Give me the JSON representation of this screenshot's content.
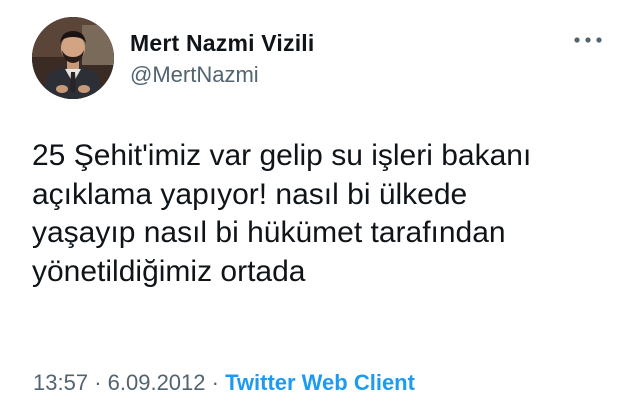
{
  "author": {
    "display_name": "Mert Nazmi Vizili",
    "handle": "@MertNazmi",
    "avatar_icon": "profile-photo"
  },
  "menu": {
    "icon": "more-horizontal-icon"
  },
  "tweet": {
    "text": "25 Şehit'imiz var gelip su işleri bakanı\naçıklama yapıyor! nasıl bi ülkede\nyaşayıp nasıl bi hükümet tarafından\nyönetildiğimiz ortada"
  },
  "meta": {
    "time": "13:57",
    "separator": "·",
    "date": "6.09.2012",
    "source": "Twitter Web Client"
  },
  "colors": {
    "text_primary": "#0f1419",
    "text_secondary": "#536471",
    "link": "#1d9bf0"
  }
}
